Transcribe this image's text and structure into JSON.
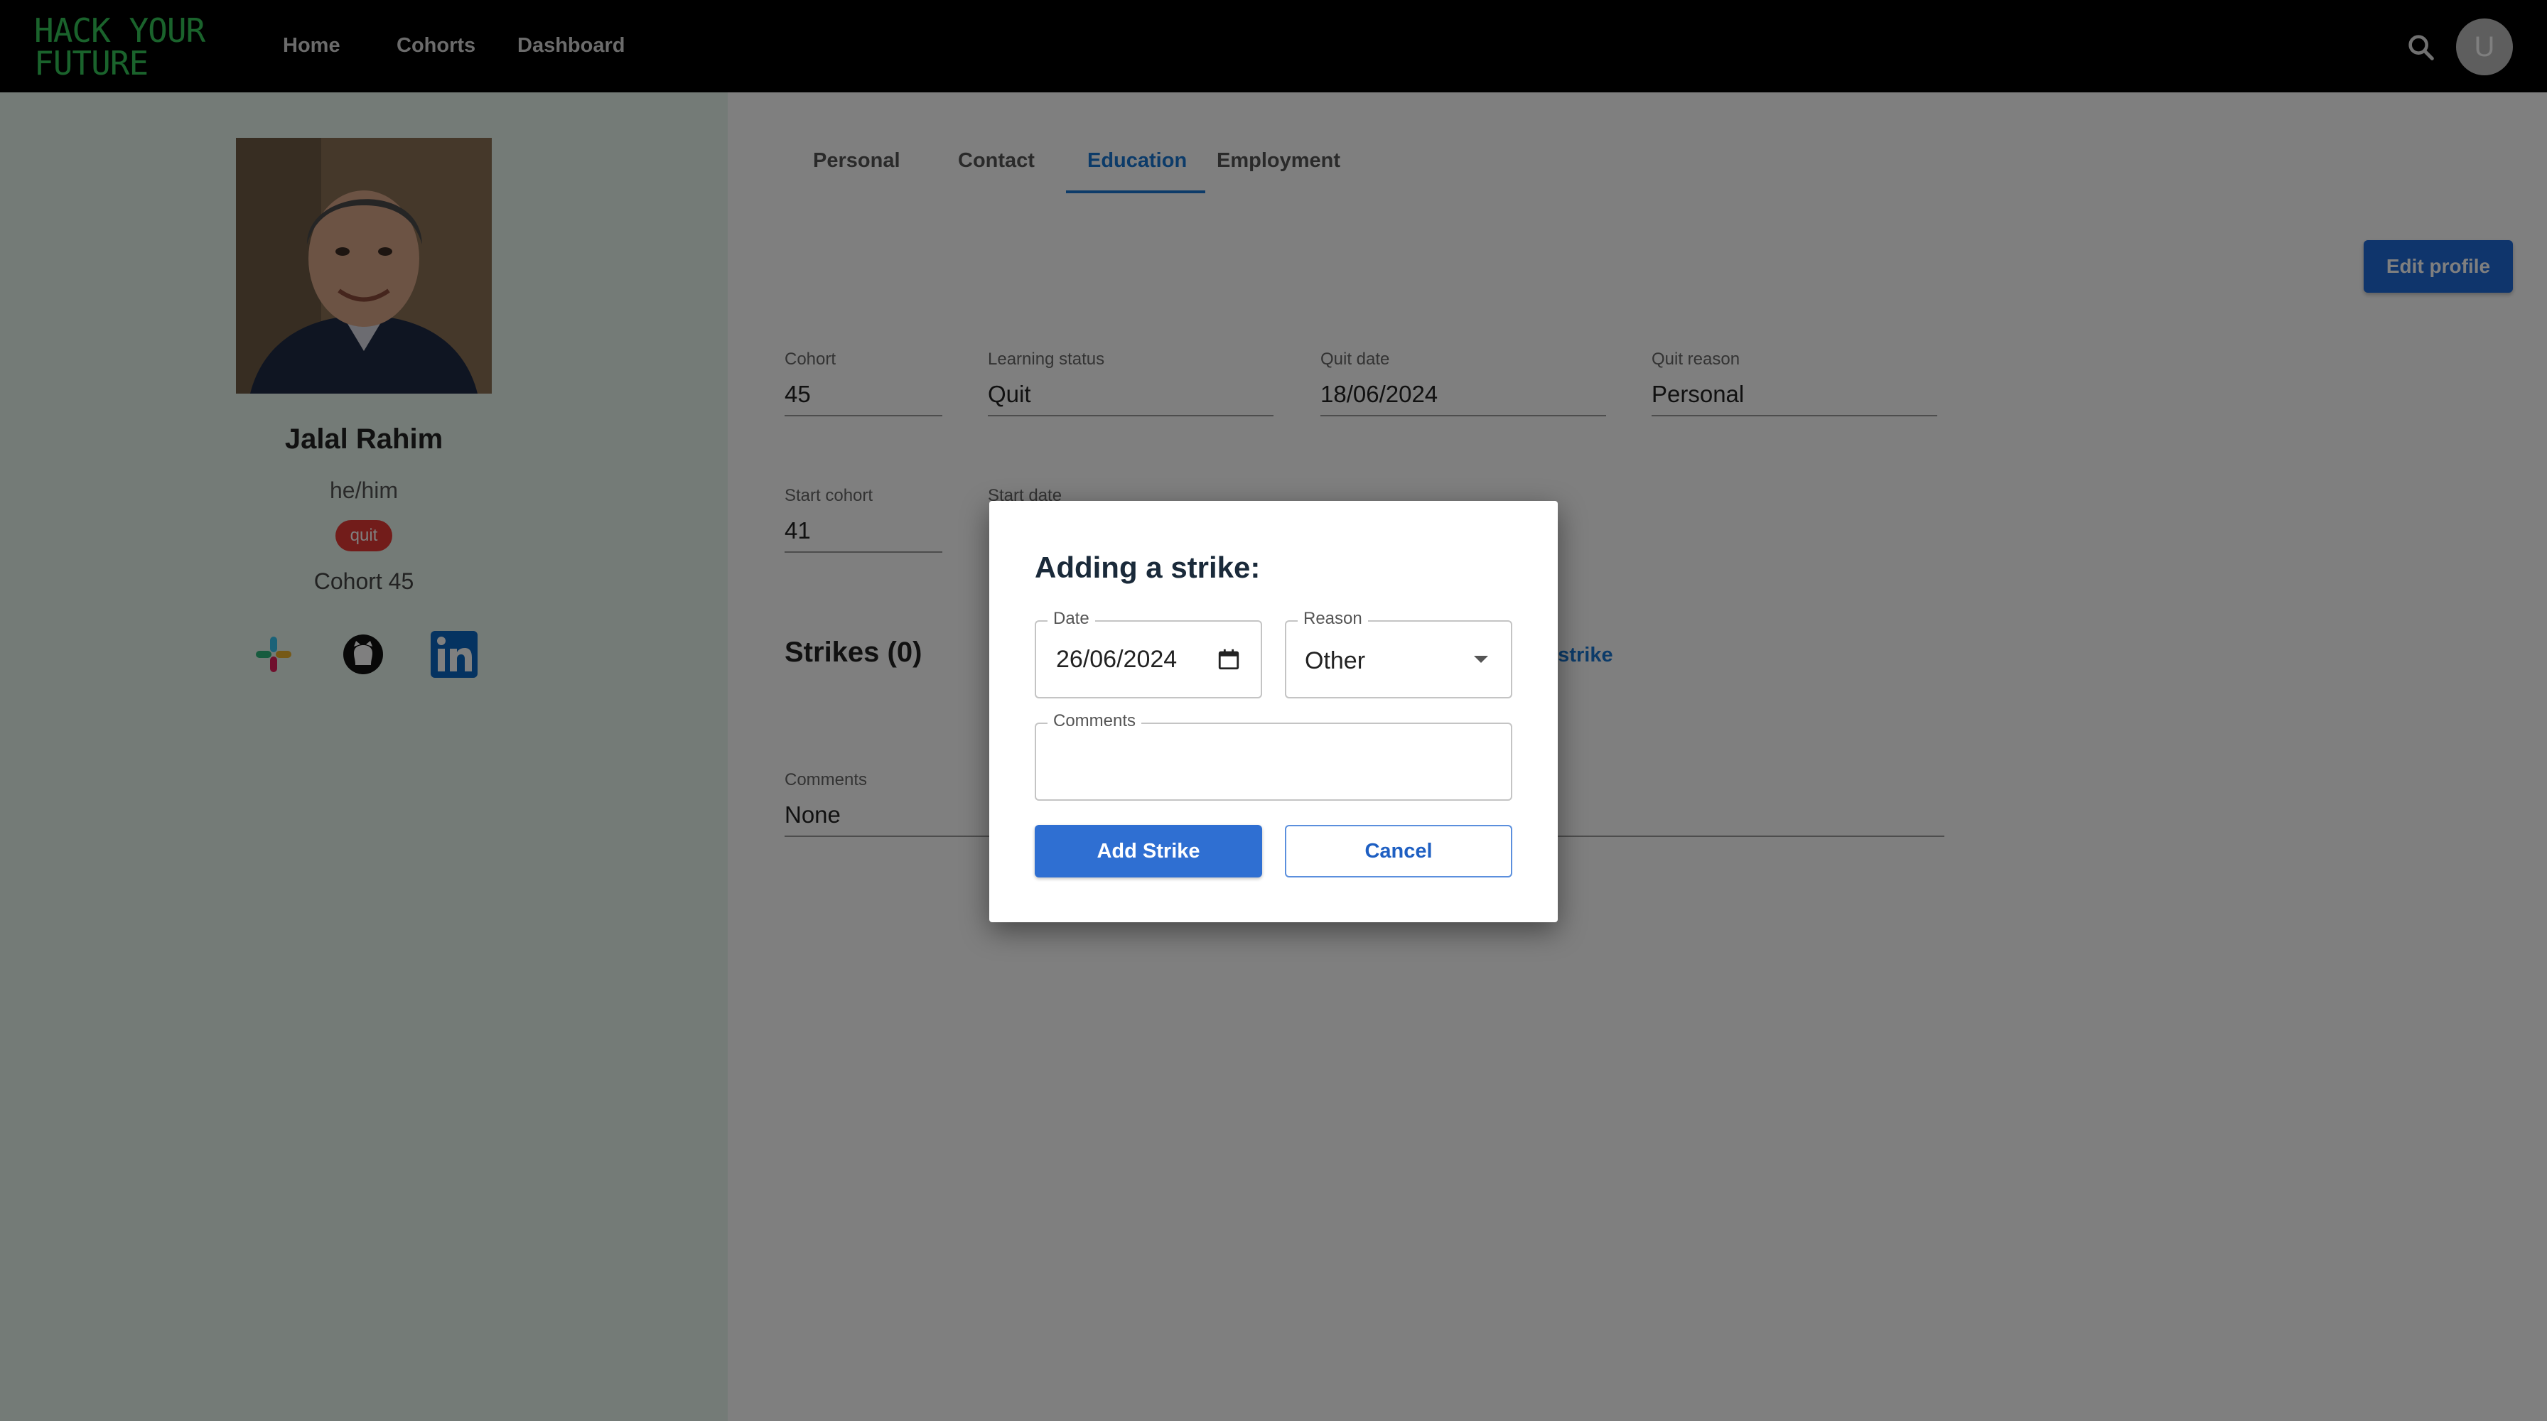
{
  "app": {
    "logo_line1": "HACK YOUR",
    "logo_line2": "FUTURE",
    "logo_color": "#35c759",
    "nav": [
      "Home",
      "Cohorts",
      "Dashboard"
    ],
    "avatar_initial": "U"
  },
  "profile": {
    "name": "Jalal Rahim",
    "pronouns": "he/him",
    "status_badge": "quit",
    "cohort_label": "Cohort 45",
    "social_icons": [
      "slack-icon",
      "github-icon",
      "linkedin-icon"
    ]
  },
  "tabs": [
    "Personal",
    "Contact",
    "Education",
    "Employment"
  ],
  "active_tab": "Education",
  "edit_profile_label": "Edit profile",
  "education": {
    "cohort_label": "Cohort",
    "cohort_value": "45",
    "learning_status_label": "Learning status",
    "learning_status_value": "Quit",
    "quit_date_label": "Quit date",
    "quit_date_value": "18/06/2024",
    "quit_reason_label": "Quit reason",
    "quit_reason_value": "Personal",
    "start_cohort_label": "Start cohort",
    "start_cohort_value": "41",
    "start_date_label": "Start date"
  },
  "strikes": {
    "title": "Strikes (0)",
    "new_strike_partial": "v strike"
  },
  "comments": {
    "label": "Comments",
    "value": "None"
  },
  "dialog": {
    "title": "Adding a strike:",
    "date_label": "Date",
    "date_value": "26/06/2024",
    "reason_label": "Reason",
    "reason_value": "Other",
    "comments_label": "Comments",
    "comments_value": "",
    "add_button": "Add Strike",
    "cancel_button": "Cancel"
  }
}
